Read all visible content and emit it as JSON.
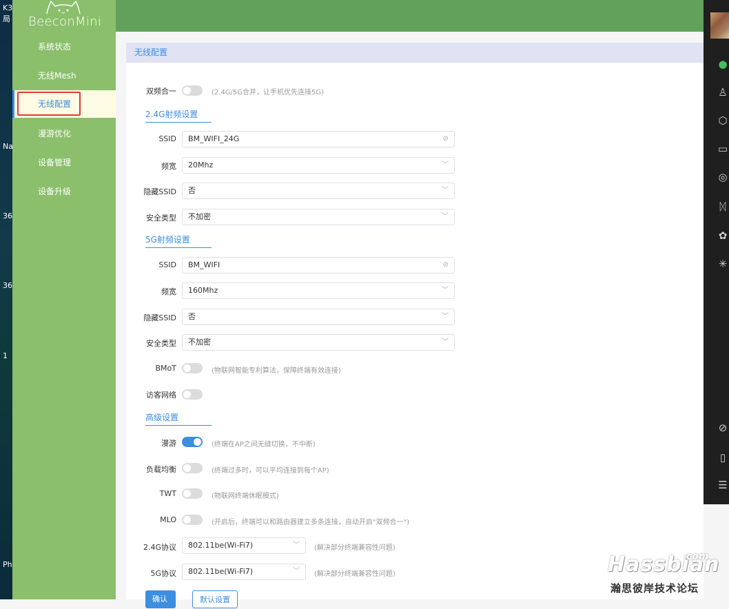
{
  "desktop": {
    "items": [
      "K3",
      "局",
      "Na",
      "36",
      "36",
      "1",
      "Ph"
    ]
  },
  "brand": {
    "name": "BeeconMini"
  },
  "sidebar": {
    "items": [
      {
        "label": "系统状态"
      },
      {
        "label": "无线Mesh"
      },
      {
        "label": "无线配置"
      },
      {
        "label": "漫游优化"
      },
      {
        "label": "设备管理"
      },
      {
        "label": "设备升级"
      }
    ],
    "active": "无线配置"
  },
  "panel": {
    "title": "无线配置"
  },
  "form": {
    "dual_band": {
      "label": "双频合一",
      "on": false,
      "hint": "(2.4G/5G合并，让手机优先连接5G)"
    },
    "band24": {
      "section": "2.4G射频设置",
      "ssid_label": "SSID",
      "ssid_value": "BM_WIFI_24G",
      "bw_label": "频宽",
      "bw_value": "20Mhz",
      "hidden_label": "隐藏SSID",
      "hidden_value": "否",
      "sec_label": "安全类型",
      "sec_value": "不加密"
    },
    "band5": {
      "section": "5G射频设置",
      "ssid_label": "SSID",
      "ssid_value": "BM_WIFI",
      "bw_label": "频宽",
      "bw_value": "160Mhz",
      "hidden_label": "隐藏SSID",
      "hidden_value": "否",
      "sec_label": "安全类型",
      "sec_value": "不加密"
    },
    "bmot": {
      "label": "BMoT",
      "on": false,
      "hint": "(物联网智能专利算法，保障终端有效连接)"
    },
    "guest": {
      "label": "访客网络",
      "on": false
    },
    "advanced": {
      "section": "高级设置",
      "roam": {
        "label": "漫游",
        "on": true,
        "hint": "(终端在AP之间无缝切换，不中断)"
      },
      "balance": {
        "label": "负载均衡",
        "on": false,
        "hint": "(终端过多时，可以平均连接到每个AP)"
      },
      "twt": {
        "label": "TWT",
        "on": false,
        "hint": "(物联网终端休眠模式)"
      },
      "mlo": {
        "label": "MLO",
        "on": false,
        "hint": "(开启后，终端可以和路由器建立多条连接，自动开启\"双频合一\")"
      },
      "proto24": {
        "label": "2.4G协议",
        "value": "802.11be(Wi-Fi7)",
        "hint": "(解决部分终端兼容性问题)"
      },
      "proto5": {
        "label": "5G协议",
        "value": "802.11be(Wi-Fi7)",
        "hint": "(解决部分终端兼容性问题)"
      }
    },
    "buttons": {
      "confirm": "确认",
      "default": "默认设置"
    }
  },
  "right_bar": {
    "icons": [
      "wechat-icon",
      "user-icon",
      "cube-icon",
      "folder-icon",
      "aperture-icon",
      "butterfly-icon",
      "settings-icon",
      "sparkle-icon",
      "link-icon",
      "phone-icon",
      "menu-icon"
    ]
  },
  "watermark": {
    "main": "Hassbian",
    "com": "com",
    "sub": "瀚思彼岸技术论坛"
  },
  "colors": {
    "sidebar": "#8bbf6b",
    "header": "#62a15c",
    "accent": "#3b8ee0",
    "active_bg": "#fdfbe3",
    "highlight_box": "#e53935"
  }
}
